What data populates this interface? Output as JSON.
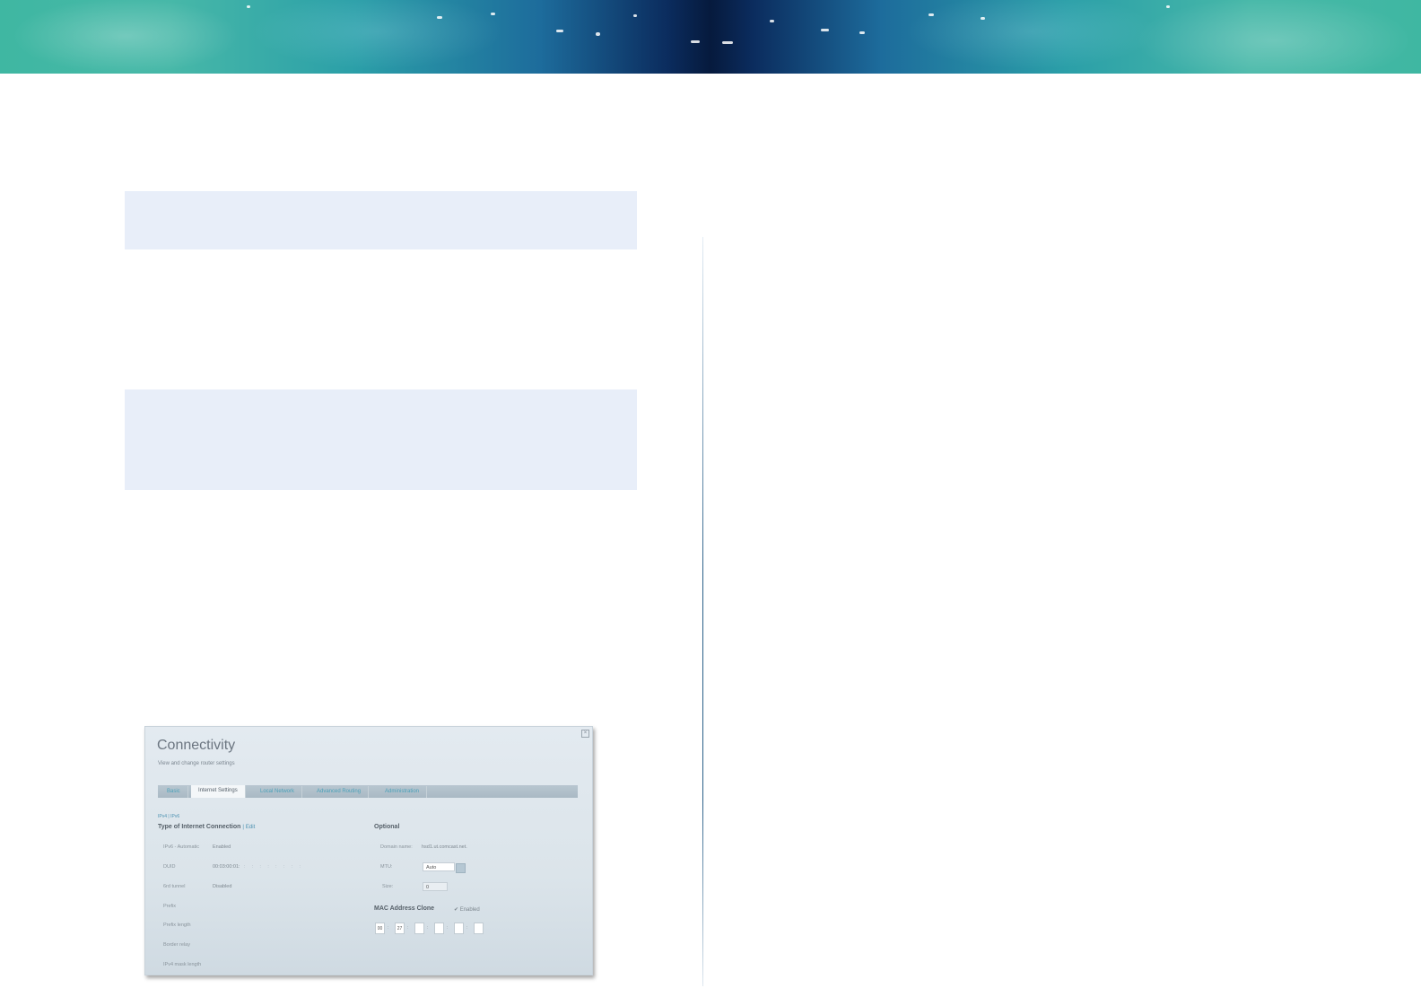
{
  "panel": {
    "title": "Connectivity",
    "subtitle": "View and change router settings",
    "close_glyph": "×",
    "tabs": [
      {
        "label": "Basic",
        "active": false
      },
      {
        "label": "Internet Settings",
        "active": true
      },
      {
        "label": "Local Network",
        "active": false
      },
      {
        "label": "Advanced Routing",
        "active": false
      },
      {
        "label": "Administration",
        "active": false
      }
    ],
    "ip_toggle": {
      "ipv4": "IPv4",
      "separator": "|",
      "ipv6": "IPv6"
    },
    "connection": {
      "heading": "Type of Internet Connection",
      "separator": "|",
      "edit_label": "Edit",
      "rows": [
        {
          "label": "IPv6 - Automatic",
          "value": "Enabled"
        },
        {
          "label": "DUID",
          "value": "00:03:00:01:",
          "ticks": ": : : : : : : :"
        },
        {
          "label": "6rd tunnel",
          "value": "Disabled"
        },
        {
          "label": "Prefix",
          "value": ""
        },
        {
          "label": "Prefix length",
          "value": ""
        },
        {
          "label": "Border relay",
          "value": ""
        },
        {
          "label": "IPv4 mask length",
          "value": ""
        }
      ]
    },
    "optional": {
      "heading": "Optional",
      "domain_label": "Domain name:",
      "domain_value": "hsd1.ut.comcast.net.",
      "mtu_label": "MTU:",
      "mtu_value": "Auto",
      "size_label": "Size:",
      "size_value": "0"
    },
    "mac_clone": {
      "heading": "MAC Address Clone",
      "enabled_label": "Enabled",
      "check_glyph": "✔",
      "octets": [
        "00",
        "27",
        "",
        "",
        "",
        ""
      ],
      "separator": ":"
    }
  }
}
